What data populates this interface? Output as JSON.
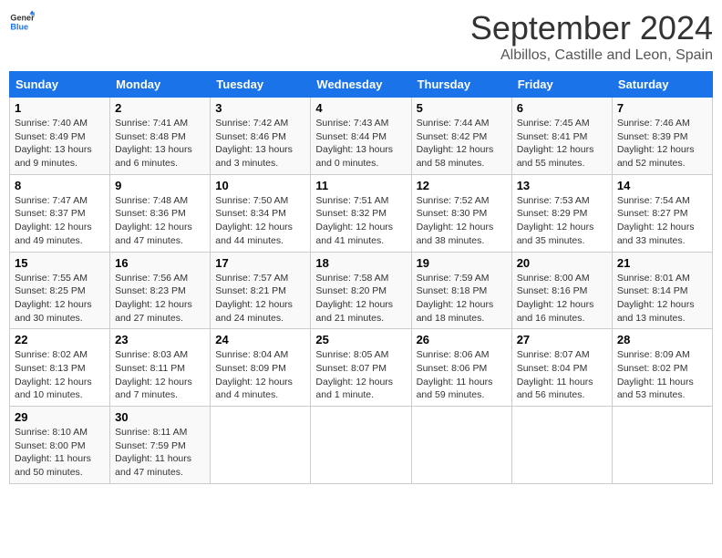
{
  "header": {
    "logo_line1": "General",
    "logo_line2": "Blue",
    "month": "September 2024",
    "location": "Albillos, Castille and Leon, Spain"
  },
  "days_of_week": [
    "Sunday",
    "Monday",
    "Tuesday",
    "Wednesday",
    "Thursday",
    "Friday",
    "Saturday"
  ],
  "weeks": [
    [
      {
        "num": "1",
        "sunrise": "7:40 AM",
        "sunset": "8:49 PM",
        "daylight": "13 hours and 9 minutes."
      },
      {
        "num": "2",
        "sunrise": "7:41 AM",
        "sunset": "8:48 PM",
        "daylight": "13 hours and 6 minutes."
      },
      {
        "num": "3",
        "sunrise": "7:42 AM",
        "sunset": "8:46 PM",
        "daylight": "13 hours and 3 minutes."
      },
      {
        "num": "4",
        "sunrise": "7:43 AM",
        "sunset": "8:44 PM",
        "daylight": "13 hours and 0 minutes."
      },
      {
        "num": "5",
        "sunrise": "7:44 AM",
        "sunset": "8:42 PM",
        "daylight": "12 hours and 58 minutes."
      },
      {
        "num": "6",
        "sunrise": "7:45 AM",
        "sunset": "8:41 PM",
        "daylight": "12 hours and 55 minutes."
      },
      {
        "num": "7",
        "sunrise": "7:46 AM",
        "sunset": "8:39 PM",
        "daylight": "12 hours and 52 minutes."
      }
    ],
    [
      {
        "num": "8",
        "sunrise": "7:47 AM",
        "sunset": "8:37 PM",
        "daylight": "12 hours and 49 minutes."
      },
      {
        "num": "9",
        "sunrise": "7:48 AM",
        "sunset": "8:36 PM",
        "daylight": "12 hours and 47 minutes."
      },
      {
        "num": "10",
        "sunrise": "7:50 AM",
        "sunset": "8:34 PM",
        "daylight": "12 hours and 44 minutes."
      },
      {
        "num": "11",
        "sunrise": "7:51 AM",
        "sunset": "8:32 PM",
        "daylight": "12 hours and 41 minutes."
      },
      {
        "num": "12",
        "sunrise": "7:52 AM",
        "sunset": "8:30 PM",
        "daylight": "12 hours and 38 minutes."
      },
      {
        "num": "13",
        "sunrise": "7:53 AM",
        "sunset": "8:29 PM",
        "daylight": "12 hours and 35 minutes."
      },
      {
        "num": "14",
        "sunrise": "7:54 AM",
        "sunset": "8:27 PM",
        "daylight": "12 hours and 33 minutes."
      }
    ],
    [
      {
        "num": "15",
        "sunrise": "7:55 AM",
        "sunset": "8:25 PM",
        "daylight": "12 hours and 30 minutes."
      },
      {
        "num": "16",
        "sunrise": "7:56 AM",
        "sunset": "8:23 PM",
        "daylight": "12 hours and 27 minutes."
      },
      {
        "num": "17",
        "sunrise": "7:57 AM",
        "sunset": "8:21 PM",
        "daylight": "12 hours and 24 minutes."
      },
      {
        "num": "18",
        "sunrise": "7:58 AM",
        "sunset": "8:20 PM",
        "daylight": "12 hours and 21 minutes."
      },
      {
        "num": "19",
        "sunrise": "7:59 AM",
        "sunset": "8:18 PM",
        "daylight": "12 hours and 18 minutes."
      },
      {
        "num": "20",
        "sunrise": "8:00 AM",
        "sunset": "8:16 PM",
        "daylight": "12 hours and 16 minutes."
      },
      {
        "num": "21",
        "sunrise": "8:01 AM",
        "sunset": "8:14 PM",
        "daylight": "12 hours and 13 minutes."
      }
    ],
    [
      {
        "num": "22",
        "sunrise": "8:02 AM",
        "sunset": "8:13 PM",
        "daylight": "12 hours and 10 minutes."
      },
      {
        "num": "23",
        "sunrise": "8:03 AM",
        "sunset": "8:11 PM",
        "daylight": "12 hours and 7 minutes."
      },
      {
        "num": "24",
        "sunrise": "8:04 AM",
        "sunset": "8:09 PM",
        "daylight": "12 hours and 4 minutes."
      },
      {
        "num": "25",
        "sunrise": "8:05 AM",
        "sunset": "8:07 PM",
        "daylight": "12 hours and 1 minute."
      },
      {
        "num": "26",
        "sunrise": "8:06 AM",
        "sunset": "8:06 PM",
        "daylight": "11 hours and 59 minutes."
      },
      {
        "num": "27",
        "sunrise": "8:07 AM",
        "sunset": "8:04 PM",
        "daylight": "11 hours and 56 minutes."
      },
      {
        "num": "28",
        "sunrise": "8:09 AM",
        "sunset": "8:02 PM",
        "daylight": "11 hours and 53 minutes."
      }
    ],
    [
      {
        "num": "29",
        "sunrise": "8:10 AM",
        "sunset": "8:00 PM",
        "daylight": "11 hours and 50 minutes."
      },
      {
        "num": "30",
        "sunrise": "8:11 AM",
        "sunset": "7:59 PM",
        "daylight": "11 hours and 47 minutes."
      },
      null,
      null,
      null,
      null,
      null
    ]
  ],
  "labels": {
    "sunrise": "Sunrise:",
    "sunset": "Sunset:",
    "daylight": "Daylight:"
  }
}
